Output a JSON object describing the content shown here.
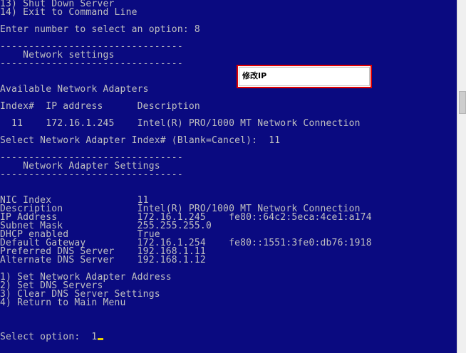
{
  "console": {
    "lines": [
      "13) Shut Down Server",
      "14) Exit to Command Line",
      "",
      "Enter number to select an option: 8",
      "",
      "--------------------------------",
      "    Network settings",
      "--------------------------------",
      "",
      "",
      "Available Network Adapters",
      "",
      "Index#  IP address      Description",
      "",
      "  11    172.16.1.245    Intel(R) PRO/1000 MT Network Connection",
      "",
      "Select Network Adapter Index# (Blank=Cancel):  11",
      "",
      "--------------------------------",
      "    Network Adapter Settings",
      "--------------------------------",
      "",
      "",
      "NIC Index               11",
      "Description             Intel(R) PRO/1000 MT Network Connection",
      "IP Address              172.16.1.245    fe80::64c2:5eca:4ce1:a174",
      "Subnet Mask             255.255.255.0",
      "DHCP enabled            True",
      "Default Gateway         172.16.1.254    fe80::1551:3fe0:db76:1918",
      "Preferred DNS Server    192.168.1.11",
      "Alternate DNS Server    192.168.1.12",
      "",
      "1) Set Network Adapter Address",
      "2) Set DNS Servers",
      "3) Clear DNS Server Settings",
      "4) Return to Main Menu",
      "",
      "",
      "",
      "Select option:  1"
    ],
    "cursor_color": "#e8d000",
    "background_color": "#0a0a80",
    "text_color": "#c0c0c0"
  },
  "annotation": {
    "text": "修改IP",
    "border_color": "#e00000"
  }
}
